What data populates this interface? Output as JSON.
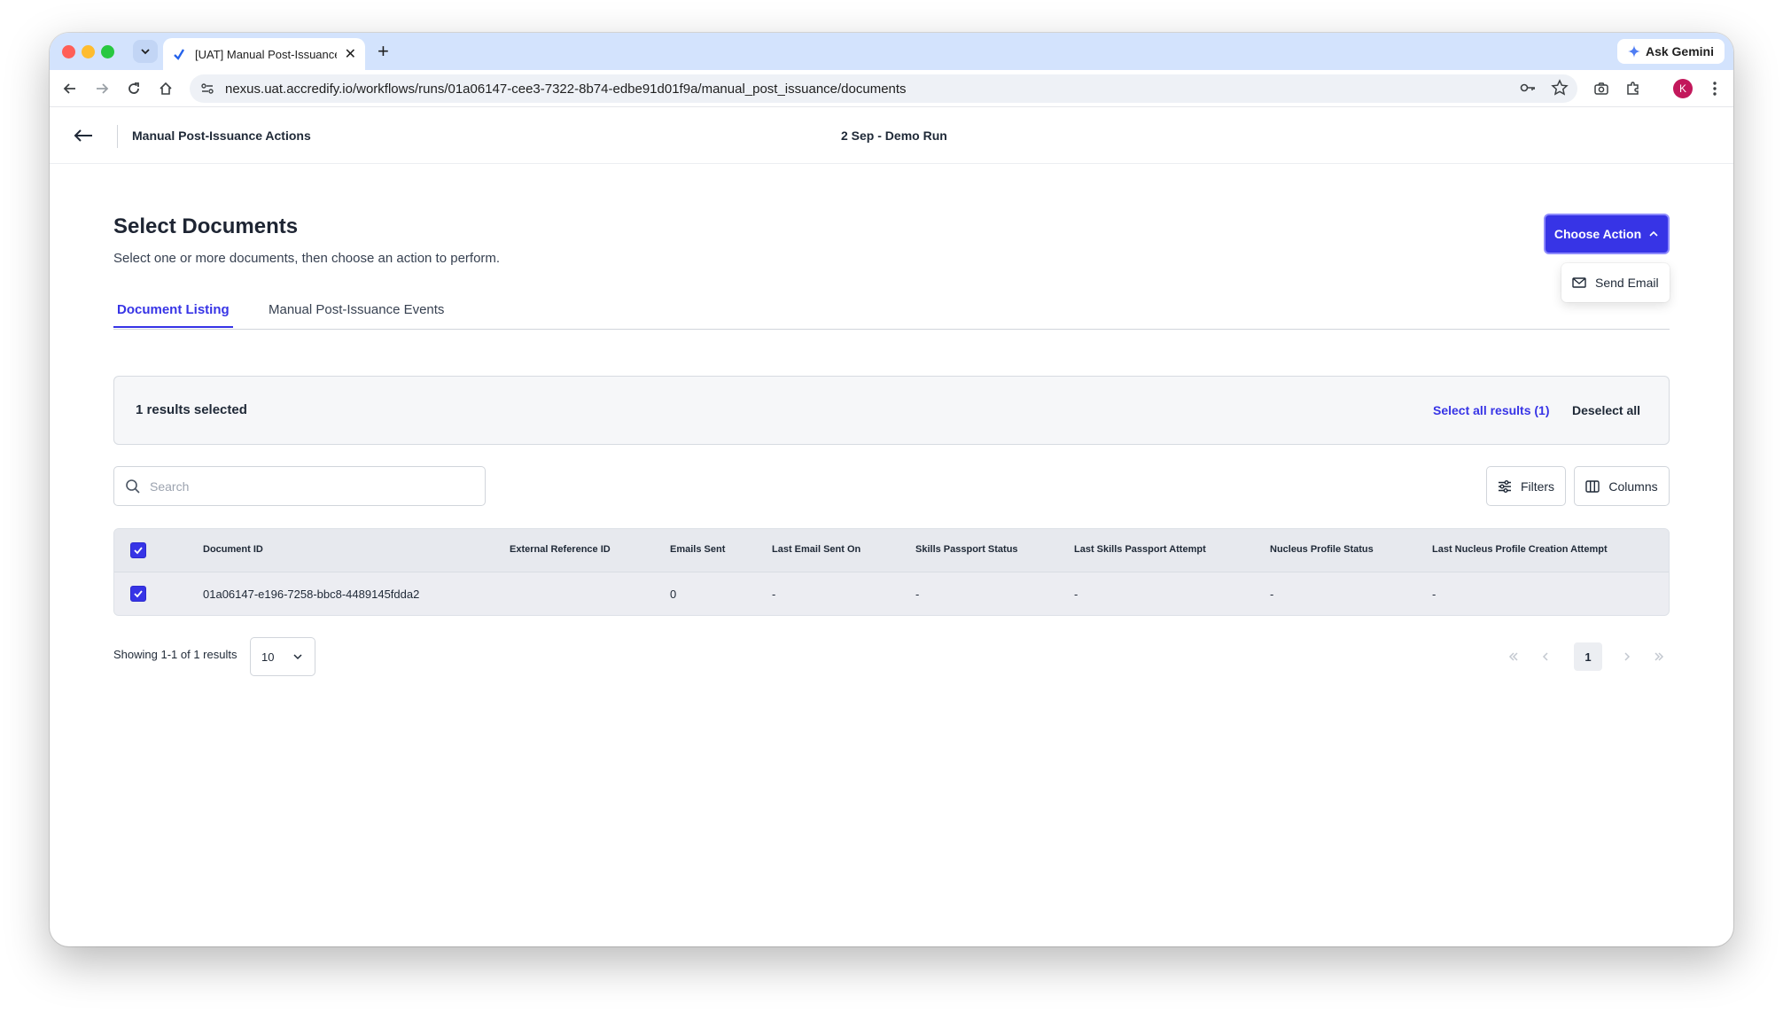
{
  "browser": {
    "tab_title": "[UAT] Manual Post-Issuance A",
    "url": "nexus.uat.accredify.io/workflows/runs/01a06147-cee3-7322-8b74-edbe91d01f9a/manual_post_issuance/documents",
    "gemini_label": "Ask Gemini",
    "profile_initial": "K"
  },
  "header": {
    "title": "Manual Post-Issuance Actions",
    "run_name": "2 Sep - Demo Run"
  },
  "page": {
    "title": "Select Documents",
    "subtitle": "Select one or more documents, then choose an action to perform.",
    "choose_action_label": "Choose Action",
    "dropdown_items": [
      "Send Email"
    ]
  },
  "tabs": [
    {
      "label": "Document Listing",
      "active": true
    },
    {
      "label": "Manual Post-Issuance Events",
      "active": false
    }
  ],
  "selection": {
    "count_text": "1 results selected",
    "select_all_text": "Select all results (1)",
    "deselect_text": "Deselect all"
  },
  "search": {
    "placeholder": "Search",
    "value": ""
  },
  "toolbar": {
    "filters_label": "Filters",
    "columns_label": "Columns"
  },
  "table": {
    "columns": [
      "Document ID",
      "External Reference ID",
      "Emails Sent",
      "Last Email Sent On",
      "Skills Passport Status",
      "Last Skills Passport Attempt",
      "Nucleus Profile Status",
      "Last Nucleus Profile Creation Attempt"
    ],
    "rows": [
      [
        "01a06147-e196-7258-bbc8-4489145fdda2",
        "",
        "0",
        "-",
        "-",
        "-",
        "-",
        "-"
      ]
    ]
  },
  "footer": {
    "showing_text": "Showing 1-1 of 1 results",
    "page_size": "10",
    "current_page": "1"
  },
  "colors": {
    "accent": "#3734e6",
    "tab_strip": "#d3e3fd"
  }
}
